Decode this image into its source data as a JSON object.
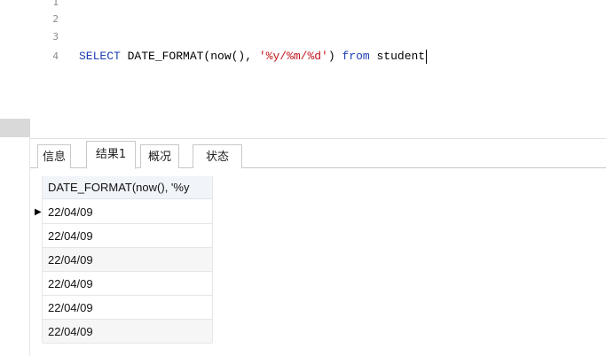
{
  "editor": {
    "line_numbers": [
      "1",
      "2",
      "3",
      "4"
    ],
    "code": {
      "kw1": "SELECT",
      "fn": " DATE_FORMAT(now(), ",
      "str": "'%y/%m/%d'",
      "paren": ") ",
      "kw2": "from",
      "table": " student"
    }
  },
  "tabs": [
    {
      "label": "信息"
    },
    {
      "label": "结果1"
    },
    {
      "label": "概况"
    },
    {
      "label": "状态"
    }
  ],
  "grid": {
    "column_header": "DATE_FORMAT(now(), '%y",
    "row_marker": "▶",
    "rows": [
      "22/04/09",
      "22/04/09",
      "22/04/09",
      "22/04/09",
      "22/04/09",
      "22/04/09"
    ]
  },
  "colors": {
    "keyword": "#1f3fb5",
    "string": "#c0161d"
  }
}
